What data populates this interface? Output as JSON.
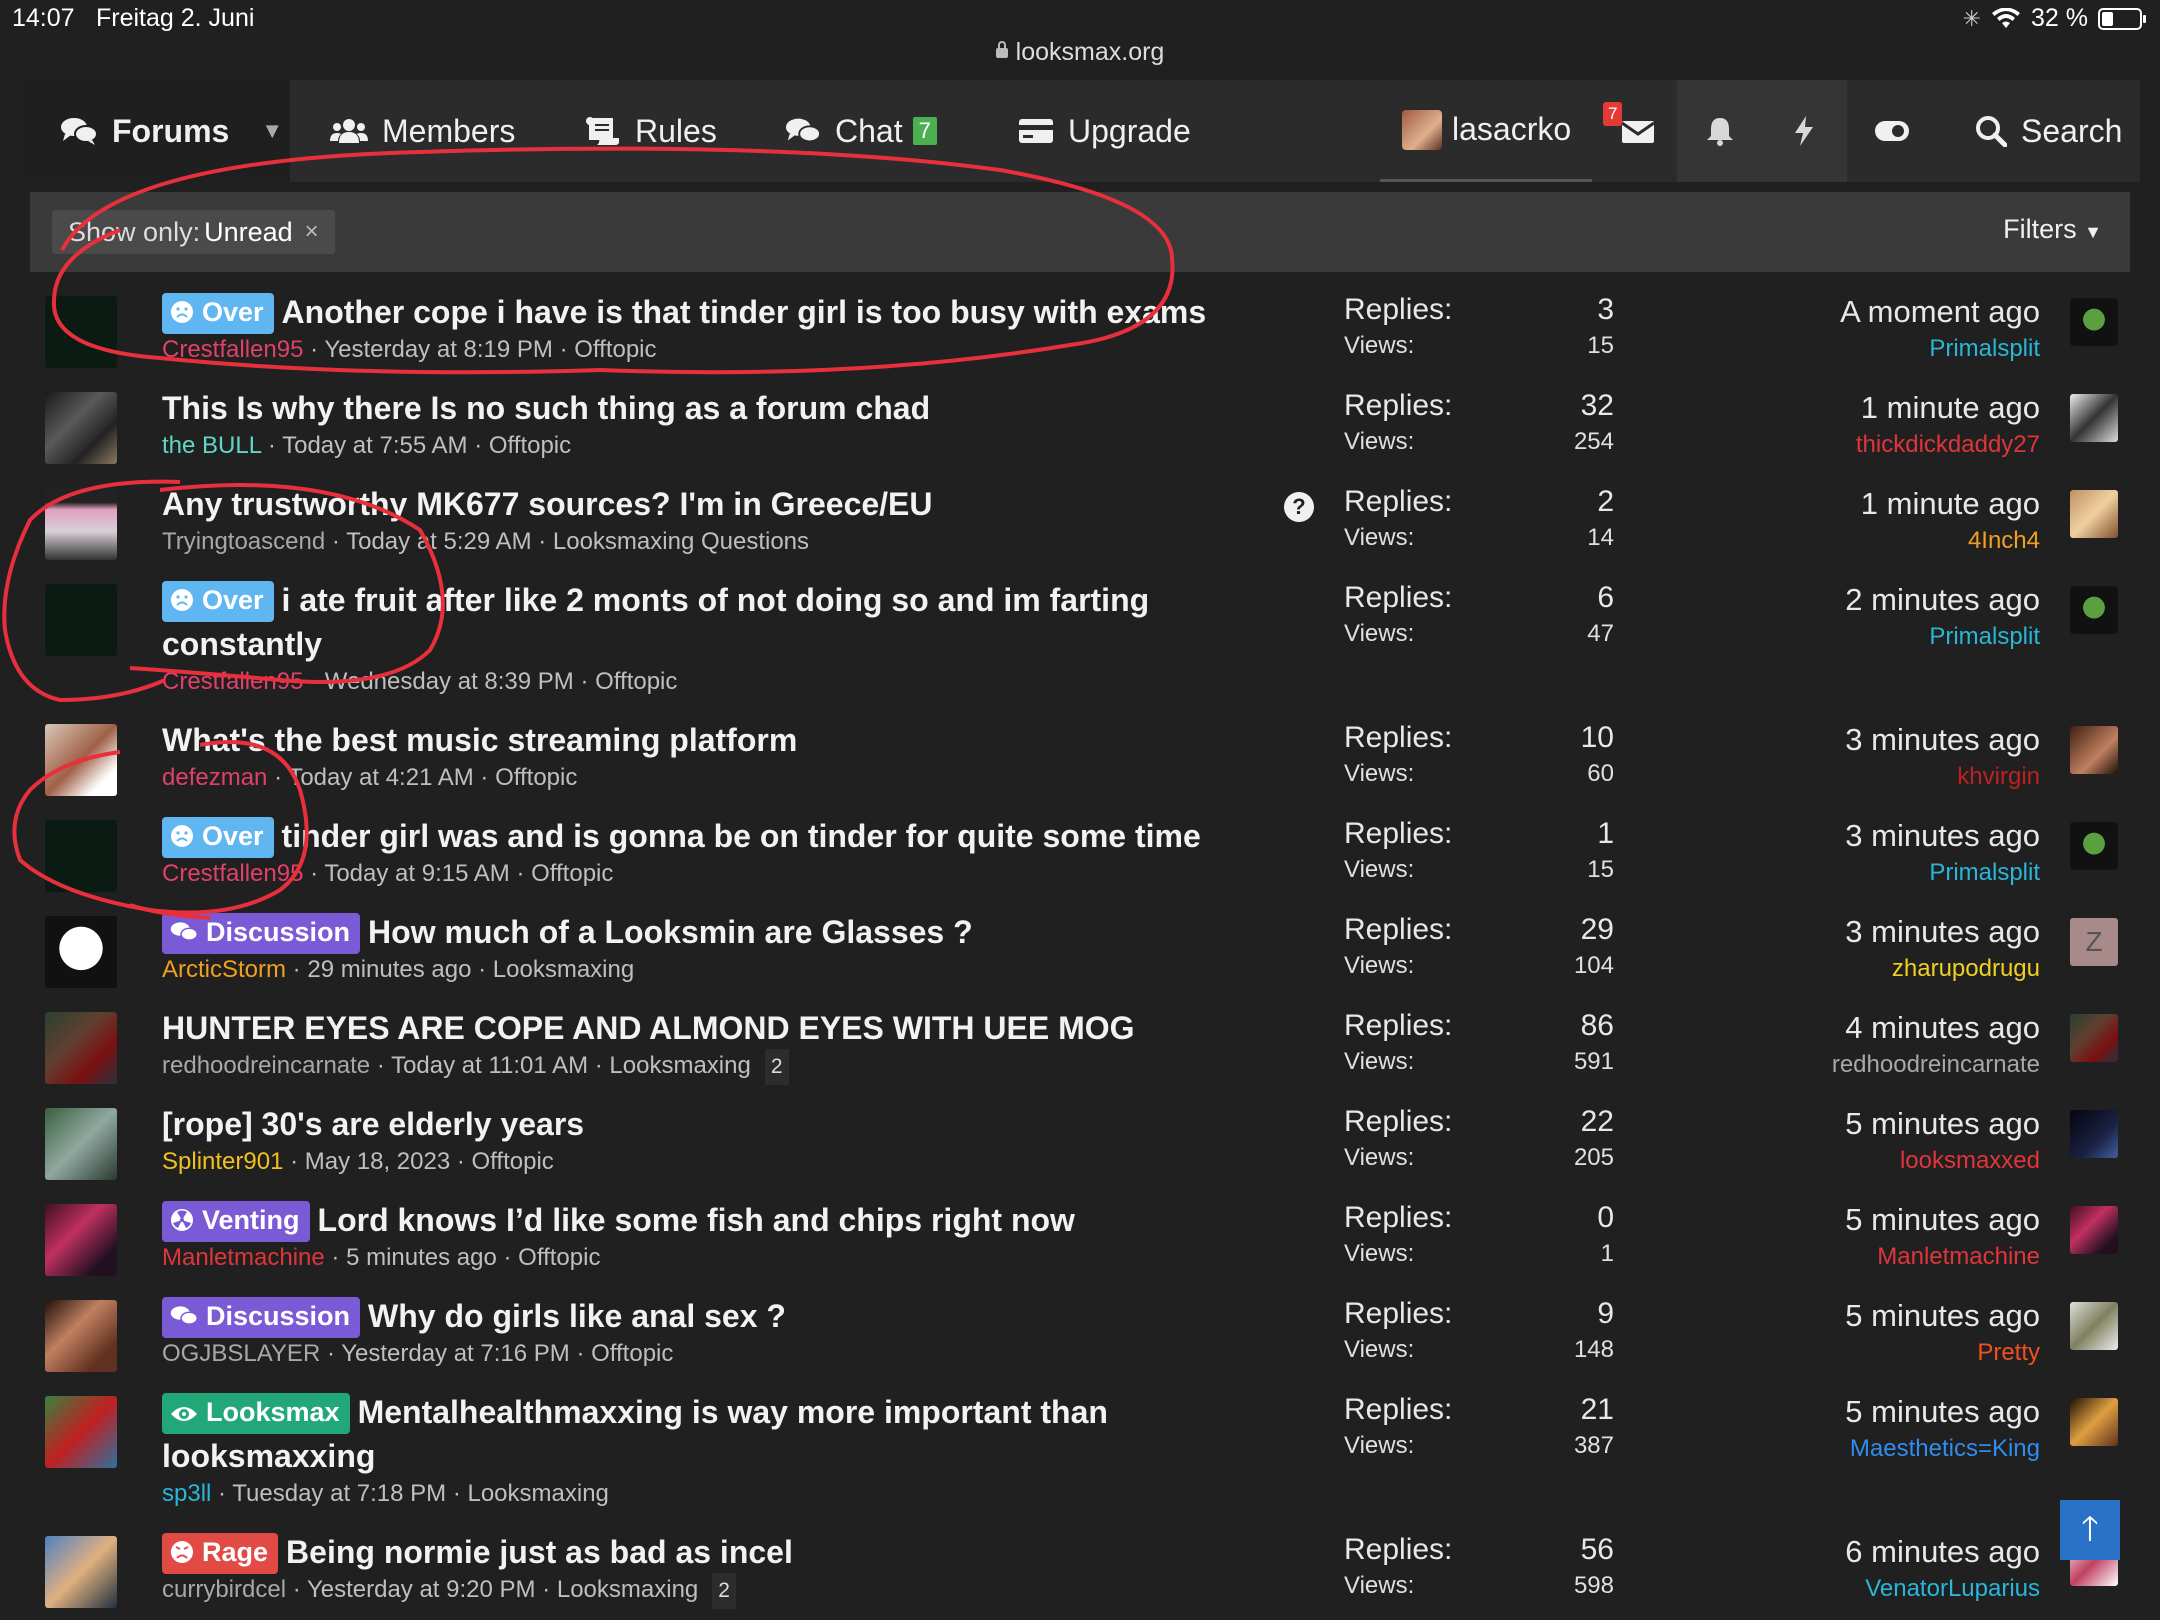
{
  "status": {
    "time": "14:07",
    "date": "Freitag 2. Juni",
    "battery": "32 %"
  },
  "browser": {
    "url": "looksmax.org"
  },
  "nav": {
    "forums": "Forums",
    "members": "Members",
    "rules": "Rules",
    "chat": "Chat",
    "chat_count": "7",
    "upgrade": "Upgrade",
    "username": "lasacrko",
    "inbox_count": "7",
    "search": "Search"
  },
  "filter": {
    "label": "Show only:",
    "value": "Unread",
    "remove": "×",
    "filters": "Filters"
  },
  "colors": {
    "over": "#5fb6f0",
    "discussion": "#7b5ad6",
    "venting": "#7b5ad6",
    "looksmax": "#22a878",
    "rage": "#e24b45",
    "annotation": "#e8303c"
  },
  "threads": [
    {
      "prefix": "Over",
      "title": "Another cope i have is that tinder girl is too busy with exams",
      "author": "Crestfallen95",
      "author_color": "#e0406a",
      "date": "Yesterday at 8:19 PM",
      "forum": "Offtopic",
      "replies_label": "Replies:",
      "replies": "3",
      "views_label": "Views:",
      "views": "15",
      "last_time": "A moment ago",
      "last_user": "Primalsplit",
      "last_color": "#29b6d8"
    },
    {
      "title": "This Is why there Is no such thing as a forum chad",
      "author": "the BULL",
      "author_color": "#5ed8c4",
      "date": "Today at 7:55 AM",
      "forum": "Offtopic",
      "replies_label": "Replies:",
      "replies": "32",
      "views_label": "Views:",
      "views": "254",
      "last_time": "1 minute ago",
      "last_user": "thickdickdaddy27",
      "last_color": "#e0353b"
    },
    {
      "title": "Any trustworthy MK677 sources? I'm in Greece/EU",
      "author": "Tryingtoascend",
      "author_color": "#a8a8a8",
      "date": "Today at 5:29 AM",
      "forum": "Looksmaxing Questions",
      "question": "?",
      "replies_label": "Replies:",
      "replies": "2",
      "views_label": "Views:",
      "views": "14",
      "last_time": "1 minute ago",
      "last_user": "4Inch4",
      "last_color": "#f0a020"
    },
    {
      "prefix": "Over",
      "title": "i ate fruit after like 2 monts of not doing so and im farting constantly",
      "author": "Crestfallen95",
      "author_color": "#e0406a",
      "date": "Wednesday at 8:39 PM",
      "forum": "Offtopic",
      "replies_label": "Replies:",
      "replies": "6",
      "views_label": "Views:",
      "views": "47",
      "last_time": "2 minutes ago",
      "last_user": "Primalsplit",
      "last_color": "#29b6d8"
    },
    {
      "title": "What's the best music streaming platform",
      "author": "defezman",
      "author_color": "#e0406a",
      "date": "Today at 4:21 AM",
      "forum": "Offtopic",
      "replies_label": "Replies:",
      "replies": "10",
      "views_label": "Views:",
      "views": "60",
      "last_time": "3 minutes ago",
      "last_user": "khvirgin",
      "last_color": "#c02020"
    },
    {
      "prefix": "Over",
      "title": "tinder girl was and is gonna be on tinder for quite some time",
      "author": "Crestfallen95",
      "author_color": "#e0406a",
      "date": "Today at 9:15 AM",
      "forum": "Offtopic",
      "replies_label": "Replies:",
      "replies": "1",
      "views_label": "Views:",
      "views": "15",
      "last_time": "3 minutes ago",
      "last_user": "Primalsplit",
      "last_color": "#29b6d8"
    },
    {
      "prefix": "Discussion",
      "title": "How much of a Looksmin are Glasses ?",
      "author": "ArcticStorm",
      "author_color": "#f0a020",
      "date": "29 minutes ago",
      "forum": "Looksmaxing",
      "replies_label": "Replies:",
      "replies": "29",
      "views_label": "Views:",
      "views": "104",
      "last_time": "3 minutes ago",
      "last_user": "zharupodrugu",
      "last_color": "#f0d020",
      "last_letter": "Z"
    },
    {
      "title": "HUNTER EYES ARE COPE AND ALMOND EYES WITH UEE MOG",
      "author": "redhoodreincarnate",
      "author_color": "#a8a8a8",
      "date": "Today at 11:01 AM",
      "forum": "Looksmaxing",
      "pages": "2",
      "replies_label": "Replies:",
      "replies": "86",
      "views_label": "Views:",
      "views": "591",
      "last_time": "4 minutes ago",
      "last_user": "redhoodreincarnate",
      "last_color": "#a8a8a8"
    },
    {
      "title": "[rope] 30's are elderly years",
      "author": "Splinter901",
      "author_color": "#f0c020",
      "date": "May 18, 2023",
      "forum": "Offtopic",
      "replies_label": "Replies:",
      "replies": "22",
      "views_label": "Views:",
      "views": "205",
      "last_time": "5 minutes ago",
      "last_user": "looksmaxxed",
      "last_color": "#e0353b"
    },
    {
      "prefix": "Venting",
      "title": "Lord knows I’d like some fish and chips right now",
      "author": "Manletmachine",
      "author_color": "#e0353b",
      "date": "5 minutes ago",
      "forum": "Offtopic",
      "replies_label": "Replies:",
      "replies": "0",
      "views_label": "Views:",
      "views": "1",
      "last_time": "5 minutes ago",
      "last_user": "Manletmachine",
      "last_color": "#e0353b"
    },
    {
      "prefix": "Discussion",
      "title": "Why do girls like anal sex ?",
      "author": "OGJBSLAYER",
      "author_color": "#a8a8a8",
      "date": "Yesterday at 7:16 PM",
      "forum": "Offtopic",
      "replies_label": "Replies:",
      "replies": "9",
      "views_label": "Views:",
      "views": "148",
      "last_time": "5 minutes ago",
      "last_user": "Pretty",
      "last_color": "#f05020"
    },
    {
      "prefix": "Looksmax",
      "title": "Mentalhealthmaxxing is way more important than looksmaxxing",
      "author": "sp3ll",
      "author_color": "#29b6d8",
      "date": "Tuesday at 7:18 PM",
      "forum": "Looksmaxing",
      "replies_label": "Replies:",
      "replies": "21",
      "views_label": "Views:",
      "views": "387",
      "last_time": "5 minutes ago",
      "last_user": "Maesthetics=King",
      "last_color": "#2f8df0"
    },
    {
      "prefix": "Rage",
      "title": "Being normie just as bad as incel",
      "author": "currybirdcel",
      "author_color": "#a8a8a8",
      "date": "Yesterday at 9:20 PM",
      "forum": "Looksmaxing",
      "pages": "2",
      "replies_label": "Replies:",
      "replies": "56",
      "views_label": "Views:",
      "views": "598",
      "last_time": "6 minutes ago",
      "last_user": "VenatorLuparius",
      "last_color": "#29b6d8"
    }
  ]
}
